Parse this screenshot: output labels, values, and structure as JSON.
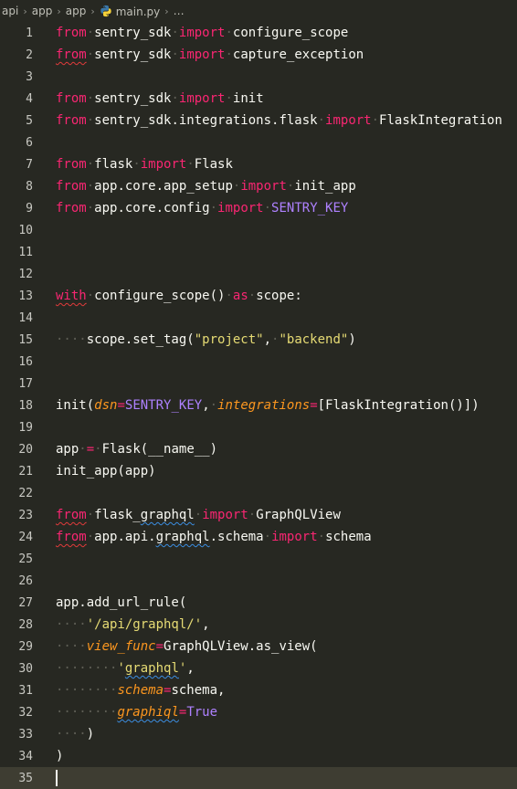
{
  "breadcrumb": {
    "items": [
      "api",
      "app",
      "app",
      "main.py",
      "…"
    ]
  },
  "editor": {
    "current_line": 35,
    "lines": [
      {
        "n": "1",
        "tokens": [
          [
            "kw",
            "from"
          ],
          [
            "",
            "·"
          ],
          [
            "",
            "sentry_sdk"
          ],
          [
            "",
            "·"
          ],
          [
            "kw",
            "import"
          ],
          [
            "",
            "·"
          ],
          [
            "",
            "configure_scope"
          ]
        ]
      },
      {
        "n": "2",
        "tokens": [
          [
            "kw squig-red",
            "from"
          ],
          [
            "",
            "·"
          ],
          [
            "",
            "sentry_sdk"
          ],
          [
            "",
            "·"
          ],
          [
            "kw",
            "import"
          ],
          [
            "",
            "·"
          ],
          [
            "",
            "capture_exception"
          ]
        ]
      },
      {
        "n": "3",
        "tokens": []
      },
      {
        "n": "4",
        "tokens": [
          [
            "kw",
            "from"
          ],
          [
            "",
            "·"
          ],
          [
            "",
            "sentry_sdk"
          ],
          [
            "",
            "·"
          ],
          [
            "kw",
            "import"
          ],
          [
            "",
            "·"
          ],
          [
            "",
            "init"
          ]
        ]
      },
      {
        "n": "5",
        "tokens": [
          [
            "kw",
            "from"
          ],
          [
            "",
            "·"
          ],
          [
            "",
            "sentry_sdk.integrations.flask"
          ],
          [
            "",
            "·"
          ],
          [
            "kw",
            "import"
          ],
          [
            "",
            "·"
          ],
          [
            "",
            "FlaskIntegration"
          ]
        ]
      },
      {
        "n": "6",
        "tokens": []
      },
      {
        "n": "7",
        "tokens": [
          [
            "kw",
            "from"
          ],
          [
            "",
            "·"
          ],
          [
            "",
            "flask"
          ],
          [
            "",
            "·"
          ],
          [
            "kw",
            "import"
          ],
          [
            "",
            "·"
          ],
          [
            "",
            "Flask"
          ]
        ]
      },
      {
        "n": "8",
        "tokens": [
          [
            "kw",
            "from"
          ],
          [
            "",
            "·"
          ],
          [
            "",
            "app.core.app_setup"
          ],
          [
            "",
            "·"
          ],
          [
            "kw",
            "import"
          ],
          [
            "",
            "·"
          ],
          [
            "",
            "init_app"
          ]
        ]
      },
      {
        "n": "9",
        "tokens": [
          [
            "kw",
            "from"
          ],
          [
            "",
            "·"
          ],
          [
            "",
            "app.core.config"
          ],
          [
            "",
            "·"
          ],
          [
            "kw",
            "import"
          ],
          [
            "",
            "·"
          ],
          [
            "cn",
            "SENTRY_KEY"
          ]
        ]
      },
      {
        "n": "10",
        "tokens": []
      },
      {
        "n": "11",
        "tokens": []
      },
      {
        "n": "12",
        "tokens": []
      },
      {
        "n": "13",
        "tokens": [
          [
            "kw squig-red",
            "with"
          ],
          [
            "",
            "·"
          ],
          [
            "",
            "configure_scope()"
          ],
          [
            "",
            "·"
          ],
          [
            "kw",
            "as"
          ],
          [
            "",
            "·"
          ],
          [
            "",
            "scope:"
          ]
        ]
      },
      {
        "n": "14",
        "tokens": []
      },
      {
        "n": "15",
        "tokens": [
          [
            "dot",
            "····"
          ],
          [
            "",
            "scope.set_tag("
          ],
          [
            "st",
            "\"project\""
          ],
          [
            "",
            ","
          ],
          [
            "",
            "·"
          ],
          [
            "st",
            "\"backend\""
          ],
          [
            "",
            ")"
          ]
        ]
      },
      {
        "n": "16",
        "tokens": []
      },
      {
        "n": "17",
        "tokens": []
      },
      {
        "n": "18",
        "tokens": [
          [
            "",
            "init("
          ],
          [
            "pa",
            "dsn"
          ],
          [
            "op",
            "="
          ],
          [
            "cn",
            "SENTRY_KEY"
          ],
          [
            "",
            ","
          ],
          [
            "",
            "·"
          ],
          [
            "pa",
            "integrations"
          ],
          [
            "op",
            "="
          ],
          [
            "",
            "[FlaskIntegration()])"
          ]
        ]
      },
      {
        "n": "19",
        "tokens": []
      },
      {
        "n": "20",
        "tokens": [
          [
            "",
            "app"
          ],
          [
            "",
            "·"
          ],
          [
            "op",
            "="
          ],
          [
            "",
            "·"
          ],
          [
            "",
            "Flask(__name__)"
          ]
        ]
      },
      {
        "n": "21",
        "tokens": [
          [
            "",
            "init_app(app)"
          ]
        ]
      },
      {
        "n": "22",
        "tokens": []
      },
      {
        "n": "23",
        "tokens": [
          [
            "kw squig-red",
            "from"
          ],
          [
            "",
            "·"
          ],
          [
            "",
            "flask_"
          ],
          [
            "squig-blue",
            "graphql"
          ],
          [
            "",
            "·"
          ],
          [
            "kw",
            "import"
          ],
          [
            "",
            "·"
          ],
          [
            "",
            "GraphQLView"
          ]
        ]
      },
      {
        "n": "24",
        "tokens": [
          [
            "kw squig-red",
            "from"
          ],
          [
            "",
            "·"
          ],
          [
            "",
            "app.api."
          ],
          [
            "squig-blue",
            "graphql"
          ],
          [
            "",
            ".schema"
          ],
          [
            "",
            "·"
          ],
          [
            "kw",
            "import"
          ],
          [
            "",
            "·"
          ],
          [
            "",
            "schema"
          ]
        ]
      },
      {
        "n": "25",
        "tokens": []
      },
      {
        "n": "26",
        "tokens": []
      },
      {
        "n": "27",
        "tokens": [
          [
            "",
            "app.add_url_rule("
          ]
        ]
      },
      {
        "n": "28",
        "tokens": [
          [
            "dot",
            "····"
          ],
          [
            "st",
            "'/api/graphql/'"
          ],
          [
            "",
            ","
          ]
        ]
      },
      {
        "n": "29",
        "tokens": [
          [
            "dot",
            "····"
          ],
          [
            "pa",
            "view_func"
          ],
          [
            "op",
            "="
          ],
          [
            "",
            "GraphQLView.as_view("
          ]
        ]
      },
      {
        "n": "30",
        "tokens": [
          [
            "dot",
            "········"
          ],
          [
            "st",
            "'"
          ],
          [
            "st squig-blue",
            "graphql"
          ],
          [
            "st",
            "'"
          ],
          [
            "",
            ","
          ]
        ]
      },
      {
        "n": "31",
        "tokens": [
          [
            "dot",
            "········"
          ],
          [
            "pa",
            "schema"
          ],
          [
            "op",
            "="
          ],
          [
            "",
            "schema,"
          ]
        ]
      },
      {
        "n": "32",
        "tokens": [
          [
            "dot",
            "········"
          ],
          [
            "pa squig-blue",
            "graphiql"
          ],
          [
            "op",
            "="
          ],
          [
            "cn",
            "True"
          ]
        ]
      },
      {
        "n": "33",
        "tokens": [
          [
            "dot",
            "····"
          ],
          [
            "",
            ")"
          ]
        ]
      },
      {
        "n": "34",
        "tokens": [
          [
            "",
            ")"
          ]
        ]
      },
      {
        "n": "35",
        "tokens": [
          [
            "cursor",
            ""
          ]
        ]
      }
    ]
  },
  "colors": {
    "background": "#272822",
    "keyword": "#f92672",
    "string": "#e6db74",
    "constant": "#ae81ff",
    "param": "#fd971f"
  },
  "icons": {
    "file_icon": "python-icon"
  }
}
